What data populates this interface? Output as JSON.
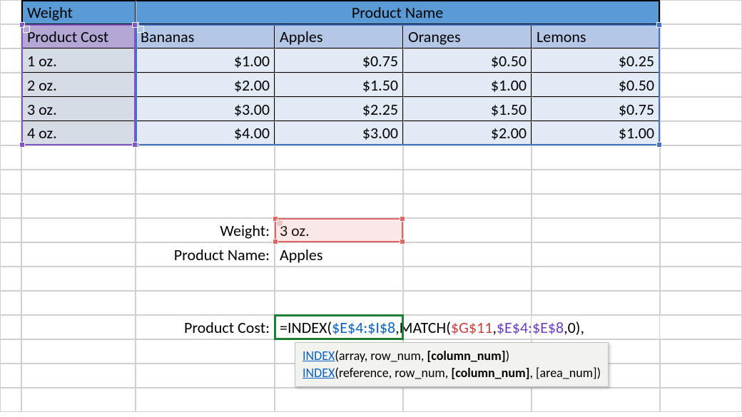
{
  "header": {
    "weight": "Weight",
    "product_name": "Product Name",
    "product_cost": "Product Cost"
  },
  "columns": [
    "Bananas",
    "Apples",
    "Oranges",
    "Lemons"
  ],
  "rows": [
    "1 oz.",
    "2 oz.",
    "3 oz.",
    "4 oz."
  ],
  "prices": [
    [
      "$1.00",
      "$0.75",
      "$0.50",
      "$0.25"
    ],
    [
      "$2.00",
      "$1.50",
      "$1.00",
      "$0.50"
    ],
    [
      "$3.00",
      "$2.25",
      "$1.50",
      "$0.75"
    ],
    [
      "$4.00",
      "$3.00",
      "$2.00",
      "$1.00"
    ]
  ],
  "lookup": {
    "weight_label": "Weight:",
    "weight_value": "3 oz.",
    "name_label": "Product Name:",
    "name_value": "Apples",
    "cost_label": "Product Cost:"
  },
  "formula": {
    "eq": "=",
    "fn_index": "INDEX",
    "fn_match": "MATCH",
    "ref_table": "$E$4:$I$8",
    "ref_lookup": "$G$11",
    "ref_col": "$E$4:$E$8",
    "zero": "0",
    "open": "(",
    "close": ")",
    "comma": ","
  },
  "tooltip": {
    "sig1_fn": "INDEX",
    "sig1_rest_a": "(array, row_num, ",
    "sig1_bold": "[column_num]",
    "sig1_rest_b": ")",
    "sig2_fn": "INDEX",
    "sig2_rest_a": "(reference, row_num, ",
    "sig2_bold": "[column_num]",
    "sig2_rest_b": ", [area_num])"
  }
}
